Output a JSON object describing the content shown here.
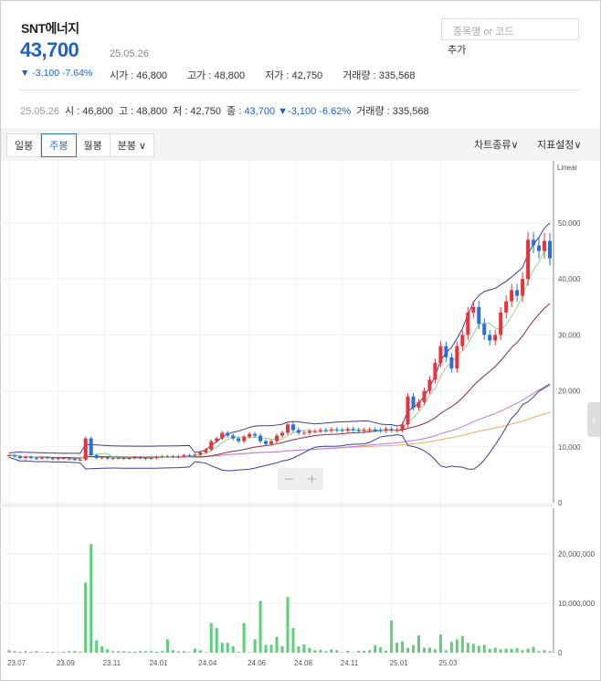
{
  "stock": {
    "name": "SNT에너지",
    "price": "43,700",
    "date": "25.05.26",
    "change": "▼ -3,100 -7.64%",
    "open": "시가 : 46,800",
    "high": "고가 : 48,800",
    "low": "저가 : 42,750",
    "volume": "거래량 : 335,568"
  },
  "search": {
    "placeholder": "종목명 or 코드",
    "add_label": "추가"
  },
  "ohlc_line": {
    "date": "25.05.26",
    "open": "시 : 46,800",
    "high": "고 : 48,800",
    "low": "저 : 42,750",
    "close_label": "종 : ",
    "close": "43,700",
    "change": "▼-3,100 -6.62%",
    "volume": "거래량 : 335,568"
  },
  "toolbar": {
    "tabs": [
      "일봉",
      "주봉",
      "월봉",
      "분봉 ∨"
    ],
    "active_tab": "주봉",
    "chart_type": "차트종류∨",
    "indicator": "지표설정∨"
  },
  "colors": {
    "up": "#e8323c",
    "down": "#2a6fd6",
    "volume": "#5ccf7a",
    "ma5": "#8fd48f",
    "ma20": "#8b2a3a",
    "ma60": "#b37de0",
    "ma120": "#f0a860",
    "bollinger": "#3a3f8f"
  },
  "chart_data": {
    "type": "candlestick",
    "scale": "Linear",
    "price_ticks": [
      "0",
      "10,000",
      "20,000",
      "30,000",
      "40,000",
      "50,000"
    ],
    "price_ylim": [
      0,
      50000
    ],
    "volume_ticks": [
      "0",
      "10,000,000",
      "20,000,000"
    ],
    "volume_ylim": [
      0,
      25000000
    ],
    "x_ticks": [
      "23.07",
      "23.09",
      "23.11",
      "24.01",
      "24.04",
      "24.06",
      "24.08",
      "24.11",
      "25.01",
      "25.03"
    ],
    "close": [
      8500,
      8300,
      8000,
      8200,
      8000,
      7900,
      8100,
      8000,
      7800,
      8000,
      7900,
      7800,
      7700,
      7700,
      11500,
      8500,
      8000,
      8100,
      7900,
      8000,
      8000,
      7900,
      8000,
      8100,
      8000,
      7900,
      8000,
      8200,
      8300,
      8300,
      8200,
      8300,
      8500,
      8400,
      8600,
      9000,
      9500,
      11000,
      11500,
      12500,
      12000,
      11500,
      11000,
      11800,
      12300,
      12000,
      11000,
      10500,
      11000,
      12000,
      12500,
      14000,
      13000,
      12500,
      12500,
      12800,
      12800,
      13000,
      12900,
      13100,
      13000,
      12900,
      13200,
      13000,
      12800,
      13000,
      13100,
      13000,
      12900,
      13200,
      13000,
      13000,
      14000,
      19000,
      17000,
      18000,
      20000,
      22000,
      25000,
      28000,
      26000,
      24000,
      28000,
      30000,
      34000,
      35000,
      32000,
      30000,
      29000,
      30000,
      34000,
      36000,
      38000,
      37000,
      40000,
      47000,
      46000,
      45000,
      46800,
      43700
    ],
    "volume": [
      0.5,
      0.3,
      0.2,
      0.3,
      0.2,
      0.3,
      0.1,
      0.2,
      0.2,
      0.1,
      0.2,
      0.3,
      0.3,
      0.2,
      14.2,
      22,
      2.5,
      1.3,
      0.7,
      0.3,
      0.3,
      0.3,
      0.2,
      0.2,
      0.3,
      0.3,
      0.3,
      0.2,
      0.3,
      2.7,
      0.5,
      0.3,
      0.3,
      0.1,
      0.8,
      0.5,
      0.1,
      6,
      5,
      2,
      2,
      1.3,
      0.2,
      6,
      0.1,
      2.7,
      10.5,
      1.6,
      1.6,
      3.2,
      1.3,
      11.3,
      5,
      1.3,
      1.7,
      1,
      0.5,
      0.6,
      0.3,
      0.7,
      0.5,
      0.1,
      0.4,
      0.1,
      0.4,
      0.4,
      0.5,
      1.5,
      1.1,
      0.4,
      6.5,
      2,
      2.3,
      1,
      1.5,
      3.5,
      1,
      1,
      0.7,
      3.7,
      0.5,
      2.2,
      2.7,
      3.4,
      2,
      1.8,
      1.4,
      1.6,
      0.8,
      1,
      0.7,
      0.8,
      0.8,
      0.9,
      0.5,
      0.8,
      1.2,
      0.3,
      0.5,
      0.3
    ]
  }
}
